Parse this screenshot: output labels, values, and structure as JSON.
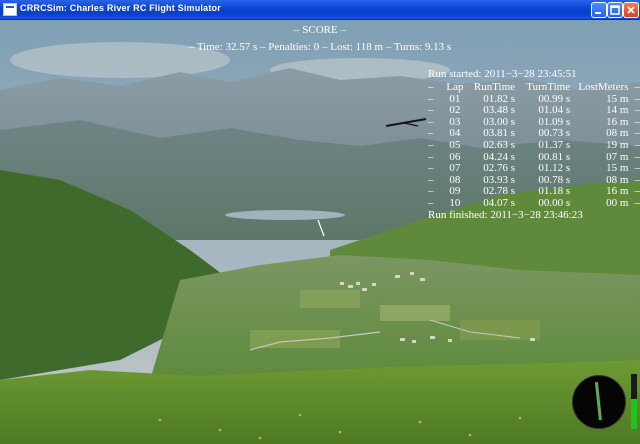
{
  "window": {
    "title": "CRRCSim: Charles River RC Flight Simulator",
    "buttons": [
      "minimize-icon",
      "maximize-icon",
      "close-icon"
    ]
  },
  "score": {
    "heading": "– SCORE –",
    "summary": "– Time: 32.57 s – Penalties: 0 – Lost: 118 m – Turns: 9.13 s"
  },
  "run": {
    "started": "Run started: 2011−3−28 23:45:51",
    "finished": "Run finished: 2011−3−28 23:46:23"
  },
  "laps_table": {
    "headers": [
      "–",
      "Lap",
      "RunTime",
      "TurnTime",
      "LostMeters",
      "–"
    ],
    "rows": [
      [
        "–",
        "01",
        "01.82 s",
        "00.99 s",
        "15 m",
        "–"
      ],
      [
        "–",
        "02",
        "03.48 s",
        "01.04 s",
        "14 m",
        "–"
      ],
      [
        "–",
        "03",
        "03.00 s",
        "01.09 s",
        "16 m",
        "–"
      ],
      [
        "–",
        "04",
        "03.81 s",
        "00.73 s",
        "08 m",
        "–"
      ],
      [
        "–",
        "05",
        "02.63 s",
        "01.37 s",
        "19 m",
        "–"
      ],
      [
        "–",
        "06",
        "04.24 s",
        "00.81 s",
        "07 m",
        "–"
      ],
      [
        "–",
        "07",
        "02.76 s",
        "01.12 s",
        "15 m",
        "–"
      ],
      [
        "–",
        "08",
        "03.93 s",
        "00.78 s",
        "08 m",
        "–"
      ],
      [
        "–",
        "09",
        "02.78 s",
        "01.18 s",
        "16 m",
        "–"
      ],
      [
        "–",
        "10",
        "04.07 s",
        "00.00 s",
        "00 m",
        "–"
      ]
    ]
  },
  "hud": {
    "throttle_level": 0.55,
    "throttle_color": "#21c321",
    "gauge_icon": "compass-gauge-icon"
  },
  "colors": {
    "titlebar": "#0b46d8",
    "overlay_text": "#ffffff"
  }
}
